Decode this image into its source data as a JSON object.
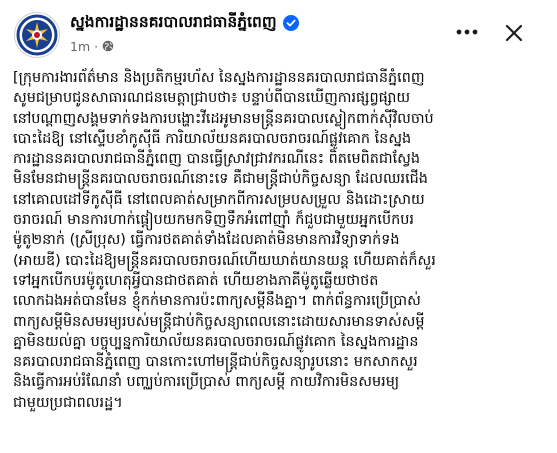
{
  "post": {
    "page_name": "ស្នងការដ្ឋាននគរបាលរាជធានីភ្នំពេញ",
    "verified": true,
    "time": "1m",
    "separator": "·",
    "privacy_icon": "globe-icon",
    "more_icon": "more-horizontal-icon",
    "close_icon": "close-icon",
    "body_lines": [
      "[ក្រុមការងារព័ត៌មាន និងប្រតិកម្មរហ័ស នៃស្នងការដ្ឋាននគរបាលរាជធានីភ្នំពេញ",
      "សូមជម្រាបជូនសាធារណជនមេត្តាជ្រាបថា៖ បន្ទាប់ពីបានឃើញការផ្សព្វផ្សាយ",
      "នៅបណ្តាញសង្គមទាក់ទងការបង្ហោះវីដេអូមានមន្ត្រីនគរបាលស្លៀកពាក់ស៊ីវិលចាប់",
      "បោះដៃឱ្យ នៅស្ទើបខាំកូស៊ីធី ការិយាល័យនគរបាលចរាចរណ៍ផ្លូវគោក នៃស្នង",
      "ការដ្ឋាននគរបាលរាជធានីភ្នំពេញ បានធ្វើស្រាវជ្រាវករណីនេះ ពិតមេពិតជាស្វែង",
      "មិនមែនជាមន្ត្រីនគរបាលចរាចរណ៍នោះទេ គឺជាមន្ត្រីជាប់កិច្ចសន្យា ដែលឈរជើង",
      "នៅគោលដៅទីកូស៊ីធី នៅពេលគាត់សម្រាកពីការសម្របសម្រួល និងដោះស្រាយ",
      "ចរាចរណ៍ មានការហាក់ផ្តៀបយកមកទិញទឹកអំពៅញ៉ាំ ក៏ជួបជាមួយអ្នកបើកបរ",
      "ម៉ូតូ២នាក់ (ស្រីប្រុស) ធ្វើការថតគាត់ទាំងដែលគាត់មិនមានការវិទ្យាទាក់ទង",
      "(អាយឌី) បោះដៃឱ្យមន្ត្រីនគរបាលចរាចរណ៍ហើយឃាត់យានយន្ត ហើយគាត់ក៏សួរ",
      "ទៅអ្នកបើកបរម៉ូតូហេតុអ្វីបានជាថតគាត់ ហើយខាងភាគីម៉ូតូឆ្លើយថាថត",
      "លោកឯងអត់បានមែន ខ្ញុំកក់មានការប៉ះពាក្យសម្តីនឹងគ្នា។ ពាក់ព័ន្ធការប្រើប្រាស់",
      "ពាក្យសម្តីមិនសមរម្យរបស់មន្ត្រីជាប់កិច្ចសន្យាពេលនោះដោយសារមានទាស់សម្តី",
      "គ្នាមិនយល់គ្នា បច្ចុប្បន្នការិយាល័យនគរបាលចរាចរណ៍ផ្លូវគោក នៃស្នងការដ្ឋាន",
      "នគរបាលរាជធានីភ្នំពេញ បានកោះហៅមន្ត្រីជាប់កិច្ចសន្យារូបនោះ មកសាកសួរ",
      "និងធ្វើការអប់រំណែនាំ បញ្ឈប់ការប្រើប្រាស់ ពាក្យសម្តី កាយវិការមិនសមរម្យ",
      "ជាមួយប្រជាពលរដ្ឋ។"
    ]
  },
  "colors": {
    "verified_blue": "#0866ff",
    "meta_grey": "#65676b",
    "text": "#050505"
  }
}
